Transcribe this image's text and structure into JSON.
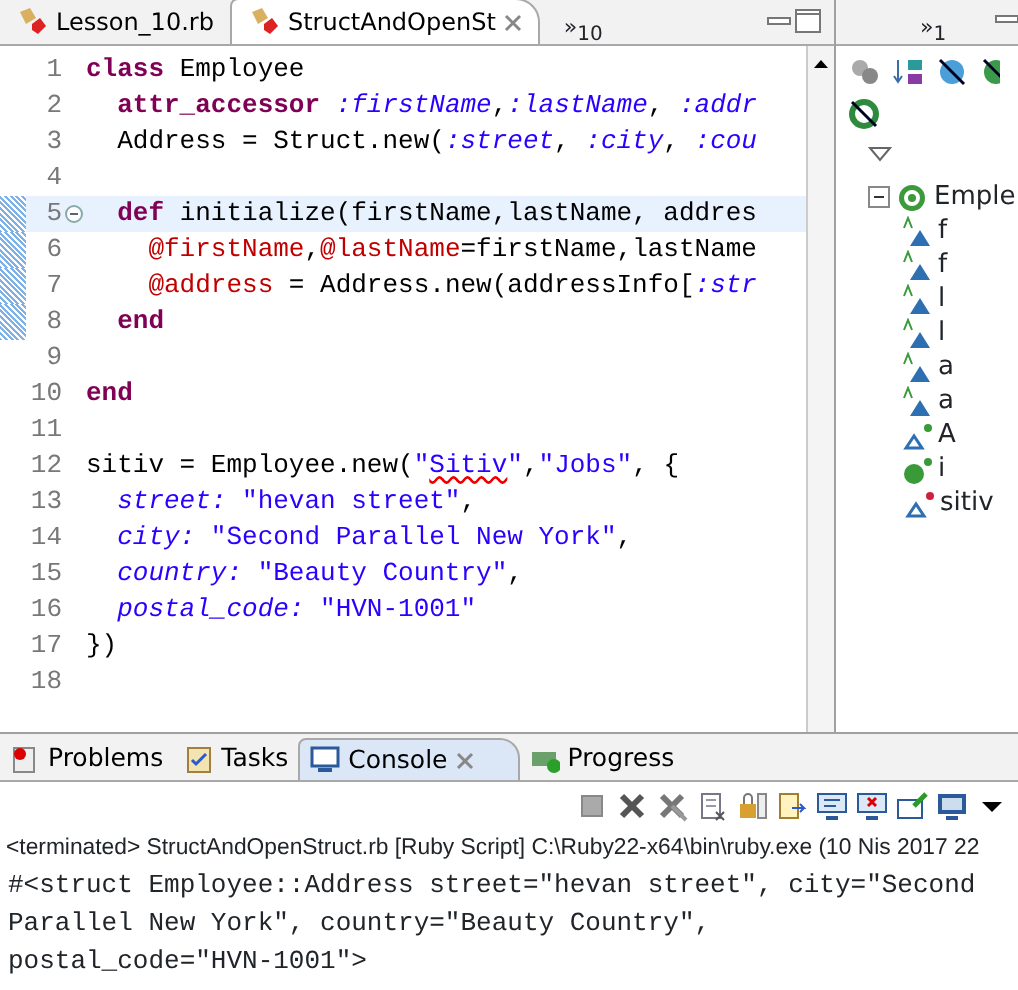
{
  "editor": {
    "tabs": [
      {
        "label": "Lesson_10.rb",
        "selected": false
      },
      {
        "label": "StructAndOpenSt",
        "selected": true
      }
    ],
    "overflow": {
      "mark": "»",
      "count": "10"
    },
    "lines": [
      {
        "number": "1",
        "current": false,
        "changed": false,
        "fold": false,
        "tokens": [
          {
            "kind": "kw",
            "text": "class"
          },
          {
            "kind": "plain",
            "text": " Employee"
          }
        ]
      },
      {
        "number": "2",
        "current": false,
        "changed": false,
        "fold": false,
        "tokens": [
          {
            "kind": "kw",
            "text": "  attr_accessor"
          },
          {
            "kind": "sym",
            "text": " :firstName"
          },
          {
            "kind": "plain",
            "text": ","
          },
          {
            "kind": "sym",
            "text": ":lastName"
          },
          {
            "kind": "plain",
            "text": ", "
          },
          {
            "kind": "sym",
            "text": ":addr"
          }
        ]
      },
      {
        "number": "3",
        "current": false,
        "changed": false,
        "fold": false,
        "tokens": [
          {
            "kind": "plain",
            "text": "  Address = Struct.new("
          },
          {
            "kind": "sym",
            "text": ":street"
          },
          {
            "kind": "plain",
            "text": ", "
          },
          {
            "kind": "sym",
            "text": ":city"
          },
          {
            "kind": "plain",
            "text": ", "
          },
          {
            "kind": "sym",
            "text": ":cou"
          }
        ]
      },
      {
        "number": "4",
        "current": false,
        "changed": false,
        "fold": false
      },
      {
        "number": "5",
        "current": true,
        "changed": true,
        "fold": true,
        "tokens": [
          {
            "kind": "kw",
            "text": "  def"
          },
          {
            "kind": "plain",
            "text": " initialize(firstName,lastName, addres"
          }
        ]
      },
      {
        "number": "6",
        "current": false,
        "changed": true,
        "fold": false,
        "tokens": [
          {
            "kind": "ivar",
            "text": "    @firstName"
          },
          {
            "kind": "plain",
            "text": ","
          },
          {
            "kind": "ivar",
            "text": "@lastName"
          },
          {
            "kind": "plain",
            "text": "=firstName,lastName"
          }
        ]
      },
      {
        "number": "7",
        "current": false,
        "changed": true,
        "fold": false,
        "tokens": [
          {
            "kind": "ivar",
            "text": "    @address"
          },
          {
            "kind": "plain",
            "text": " = Address.new(addressInfo["
          },
          {
            "kind": "sym",
            "text": ":str"
          }
        ]
      },
      {
        "number": "8",
        "current": false,
        "changed": true,
        "fold": false,
        "tokens": [
          {
            "kind": "kw",
            "text": "  end"
          }
        ]
      },
      {
        "number": "9",
        "current": false,
        "changed": false,
        "fold": false
      },
      {
        "number": "10",
        "current": false,
        "changed": false,
        "fold": false,
        "tokens": [
          {
            "kind": "kw",
            "text": "end"
          }
        ]
      },
      {
        "number": "11",
        "current": false,
        "changed": false,
        "fold": false
      },
      {
        "number": "12",
        "current": false,
        "changed": false,
        "fold": false,
        "tokens": [
          {
            "kind": "plain",
            "text": "sitiv = Employee.new("
          },
          {
            "kind": "str",
            "text": "\""
          },
          {
            "kind": "misspelled",
            "text": "Sitiv"
          },
          {
            "kind": "str",
            "text": "\""
          },
          {
            "kind": "plain",
            "text": ","
          },
          {
            "kind": "str",
            "text": "\"Jobs\""
          },
          {
            "kind": "plain",
            "text": ", {"
          }
        ]
      },
      {
        "number": "13",
        "current": false,
        "changed": false,
        "fold": false,
        "tokens": [
          {
            "kind": "sym",
            "text": "  street:"
          },
          {
            "kind": "str",
            "text": " \"hevan street\""
          },
          {
            "kind": "plain",
            "text": ","
          }
        ]
      },
      {
        "number": "14",
        "current": false,
        "changed": false,
        "fold": false,
        "tokens": [
          {
            "kind": "sym",
            "text": "  city:"
          },
          {
            "kind": "str",
            "text": " \"Second Parallel New York\""
          },
          {
            "kind": "plain",
            "text": ","
          }
        ]
      },
      {
        "number": "15",
        "current": false,
        "changed": false,
        "fold": false,
        "tokens": [
          {
            "kind": "sym",
            "text": "  country:"
          },
          {
            "kind": "str",
            "text": " \"Beauty Country\""
          },
          {
            "kind": "plain",
            "text": ","
          }
        ]
      },
      {
        "number": "16",
        "current": false,
        "changed": false,
        "fold": false,
        "tokens": [
          {
            "kind": "sym",
            "text": "  postal_code:"
          },
          {
            "kind": "str",
            "text": " \"HVN-1001\""
          }
        ]
      },
      {
        "number": "17",
        "current": false,
        "changed": false,
        "fold": false,
        "tokens": [
          {
            "kind": "plain",
            "text": "})"
          }
        ]
      },
      {
        "number": "18",
        "current": false,
        "changed": false,
        "fold": false
      }
    ]
  },
  "outline": {
    "overflow": {
      "mark": "»",
      "count": "1"
    },
    "tree": [
      {
        "label": "Emple",
        "kind": "class",
        "expanded": true,
        "children": [
          {
            "label": "f",
            "kind": "attr"
          },
          {
            "label": "f",
            "kind": "attr"
          },
          {
            "label": "l",
            "kind": "attr"
          },
          {
            "label": "l",
            "kind": "attr"
          },
          {
            "label": "a",
            "kind": "attr"
          },
          {
            "label": "a",
            "kind": "attr"
          },
          {
            "label": "A",
            "kind": "const"
          },
          {
            "label": "i",
            "kind": "method"
          }
        ]
      },
      {
        "label": "sitiv",
        "kind": "global"
      }
    ]
  },
  "console": {
    "tabs": [
      {
        "label": "Problems",
        "kind": "problems",
        "selected": false
      },
      {
        "label": "Tasks",
        "kind": "tasks",
        "selected": false
      },
      {
        "label": "Console",
        "kind": "console",
        "selected": true
      },
      {
        "label": "Progress",
        "kind": "progress",
        "selected": false
      }
    ],
    "status": "<terminated> StructAndOpenStruct.rb [Ruby Script] C:\\Ruby22-x64\\bin\\ruby.exe (10 Nis 2017 22",
    "output": [
      "#<struct Employee::Address street=\"hevan street\", city=\"Second",
      "Parallel New York\", country=\"Beauty Country\",",
      "postal_code=\"HVN-1001\">"
    ]
  }
}
